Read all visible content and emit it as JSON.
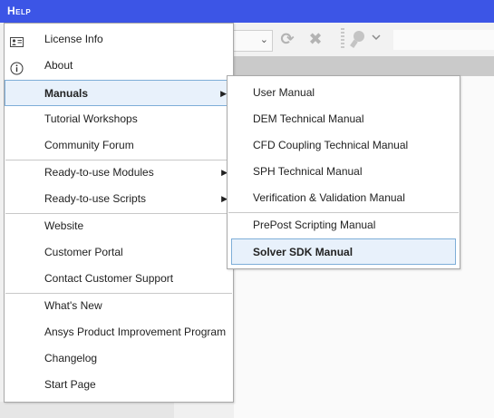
{
  "menubar": {
    "help_label": "Help"
  },
  "main_menu": {
    "items": [
      {
        "label": "License Info",
        "icon": "id-card-icon"
      },
      {
        "label": "About",
        "icon": "info-icon"
      },
      {
        "label": "Manuals",
        "has_submenu": true,
        "highlighted": true
      },
      {
        "label": "Tutorial Workshops"
      },
      {
        "label": "Community Forum"
      },
      {
        "label": "Ready-to-use Modules",
        "has_submenu": true
      },
      {
        "label": "Ready-to-use Scripts",
        "has_submenu": true
      },
      {
        "label": "Website"
      },
      {
        "label": "Customer Portal"
      },
      {
        "label": "Contact Customer Support"
      },
      {
        "label": "What's New"
      },
      {
        "label": "Ansys Product Improvement Program"
      },
      {
        "label": "Changelog"
      },
      {
        "label": "Start Page"
      }
    ]
  },
  "sub_menu": {
    "items": [
      {
        "label": "User Manual"
      },
      {
        "label": "DEM Technical Manual"
      },
      {
        "label": "CFD Coupling Technical Manual"
      },
      {
        "label": "SPH Technical Manual"
      },
      {
        "label": "Verification & Validation Manual"
      },
      {
        "label": "PrePost Scripting Manual"
      },
      {
        "label": "Solver SDK Manual",
        "highlighted": true
      }
    ]
  },
  "colors": {
    "menubar": "#3c55e6",
    "highlight_bg": "#e8f1fb",
    "highlight_border": "#7eaed8"
  }
}
